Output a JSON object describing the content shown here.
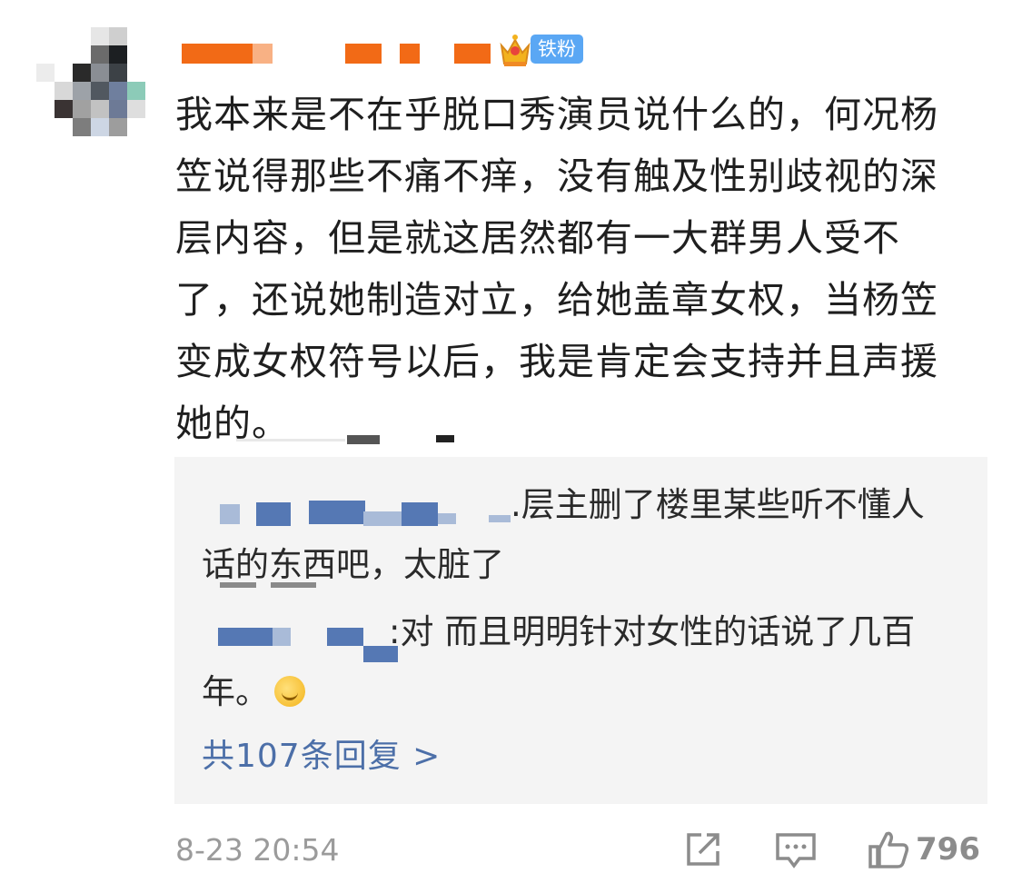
{
  "user": {
    "badge_label": "铁粉"
  },
  "comment": {
    "text": "我本来是不在乎脱口秀演员说什么的，何况杨笠说得那些不痛不痒，没有触及性别歧视的深层内容，但是就这居然都有一大群男人受不了，还说她制造对立，给她盖章女权，当杨笠变成女权符号以后，我是肯定会支持并且声援她的。"
  },
  "replies": [
    {
      "sep": ".",
      "text": "层主删了楼里某些听不懂人话的东西吧，太脏了"
    },
    {
      "sep": ":",
      "text": "对 而且明明针对女性的话说了几百年。"
    }
  ],
  "more_replies": {
    "label": "共107条回复 >"
  },
  "footer": {
    "timestamp": "8-23 20:54",
    "like_count": "796"
  },
  "icons": {
    "share": "share-icon",
    "comment": "comment-icon",
    "like": "thumbs-up-icon"
  },
  "colors": {
    "username": "#f26a16",
    "badge": "#5aa7f4",
    "link": "#4c6fa8",
    "reply_bg": "#f4f4f4"
  }
}
